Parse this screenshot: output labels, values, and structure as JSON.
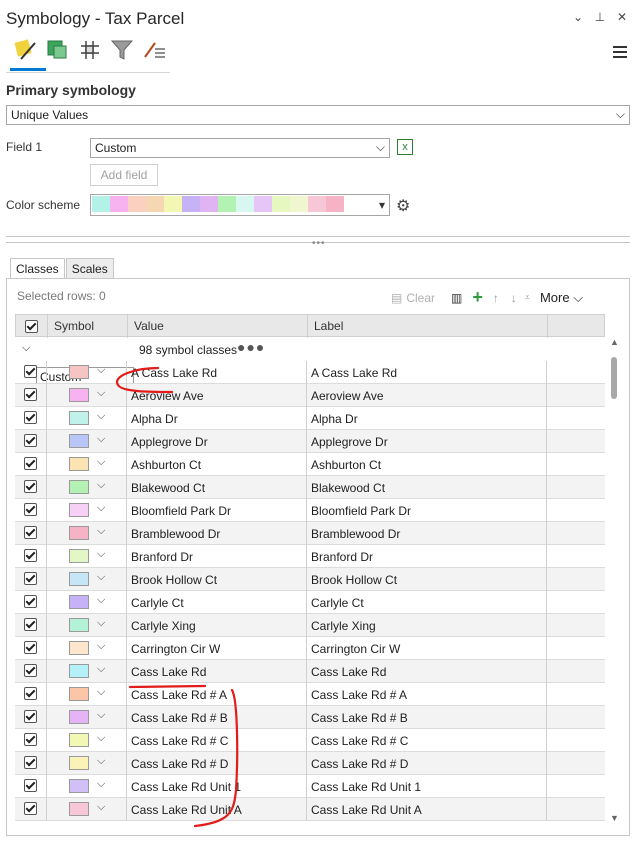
{
  "window": {
    "title": "Symbology - Tax Parcel",
    "controls": [
      "⌄",
      "⊥",
      "✕"
    ]
  },
  "toolbar": {
    "icons": [
      "primary-symbology-icon",
      "vary-symbology-icon",
      "symbol-layers-icon",
      "filter-icon",
      "label-class-icon"
    ]
  },
  "primary": {
    "title": "Primary symbology",
    "method": "Unique Values",
    "field1_label": "Field 1",
    "field1_value": "Custom",
    "add_field": "Add field",
    "color_scheme_label": "Color scheme",
    "colors": [
      "#b3f2e6",
      "#f7b3f0",
      "#fbd0c0",
      "#f7d7b3",
      "#f2f7b3",
      "#c6b3f7",
      "#e0b3f2",
      "#b3f2b3",
      "#d7f7f0",
      "#e6c6f7",
      "#e6f7c0",
      "#f0f7d0",
      "#f7c6d7",
      "#f7b3c6"
    ]
  },
  "tabs": [
    "Classes",
    "Scales"
  ],
  "classes": {
    "selected_rows": "Selected rows: 0",
    "clear": "Clear",
    "more": "More",
    "col_symbol": "Symbol",
    "col_value": "Value",
    "col_label": "Label",
    "group_name": "Custom",
    "group_count": "98 symbol classes",
    "rows": [
      {
        "value": "A Cass Lake Rd",
        "label": "A Cass Lake Rd",
        "color": "#f7c4c4"
      },
      {
        "value": "Aeroview Ave",
        "label": "Aeroview Ave",
        "color": "#f7b3f0"
      },
      {
        "value": "Alpha Dr",
        "label": "Alpha Dr",
        "color": "#c0f2ea"
      },
      {
        "value": "Applegrove Dr",
        "label": "Applegrove Dr",
        "color": "#b8c6f7"
      },
      {
        "value": "Ashburton Ct",
        "label": "Ashburton Ct",
        "color": "#fbe3b3"
      },
      {
        "value": "Blakewood Ct",
        "label": "Blakewood Ct",
        "color": "#b3f2b3"
      },
      {
        "value": "Bloomfield Park Dr",
        "label": "Bloomfield Park Dr",
        "color": "#f7d0f7"
      },
      {
        "value": "Bramblewood Dr",
        "label": "Bramblewood Dr",
        "color": "#f7b3c6"
      },
      {
        "value": "Branford Dr",
        "label": "Branford Dr",
        "color": "#e3f7c6"
      },
      {
        "value": "Brook Hollow Ct",
        "label": "Brook Hollow Ct",
        "color": "#c6e6f7"
      },
      {
        "value": "Carlyle Ct",
        "label": "Carlyle Ct",
        "color": "#c6b3f7"
      },
      {
        "value": "Carlyle Xing",
        "label": "Carlyle Xing",
        "color": "#b3f2d7"
      },
      {
        "value": "Carrington Cir W",
        "label": "Carrington Cir W",
        "color": "#fde6cc"
      },
      {
        "value": "Cass Lake Rd",
        "label": "Cass Lake Rd",
        "color": "#b3f0f7"
      },
      {
        "value": "Cass Lake Rd # A",
        "label": "Cass Lake Rd # A",
        "color": "#fbc6a8"
      },
      {
        "value": "Cass Lake Rd # B",
        "label": "Cass Lake Rd # B",
        "color": "#e6b3f7"
      },
      {
        "value": "Cass Lake Rd # C",
        "label": "Cass Lake Rd # C",
        "color": "#f2f7b3"
      },
      {
        "value": "Cass Lake Rd # D",
        "label": "Cass Lake Rd # D",
        "color": "#fbf2b8"
      },
      {
        "value": "Cass Lake Rd Unit 1",
        "label": "Cass Lake Rd Unit 1",
        "color": "#d0c0f7"
      },
      {
        "value": "Cass Lake Rd Unit A",
        "label": "Cass Lake Rd Unit A",
        "color": "#f7c6d7"
      }
    ]
  }
}
